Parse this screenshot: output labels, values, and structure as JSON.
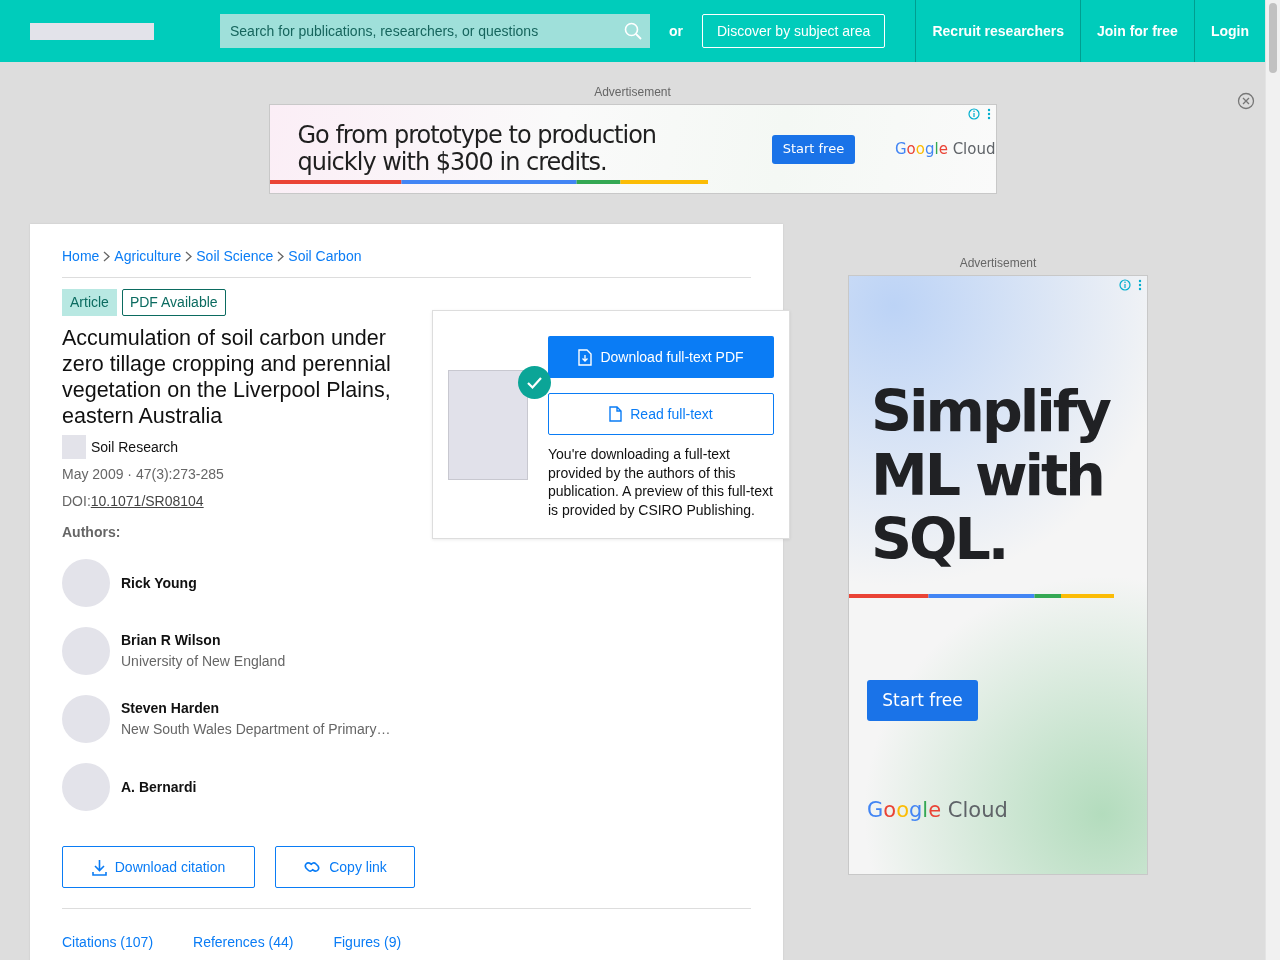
{
  "header": {
    "search": {
      "placeholder": "Search for publications, researchers, or questions"
    },
    "or_text": "or",
    "discover_button": "Discover by subject area",
    "nav_links": [
      "Recruit researchers",
      "Join for free",
      "Login"
    ]
  },
  "top_ad": {
    "label": "Advertisement",
    "headline": "Go from prototype to production quickly with $300 in credits.",
    "button": "Start free",
    "brand": [
      "Google",
      "Cloud"
    ]
  },
  "article": {
    "breadcrumbs": [
      "Home",
      "Agriculture",
      "Soil Science",
      "Soil Carbon"
    ],
    "badges": [
      {
        "label": "Article",
        "kind": "filled"
      },
      {
        "label": "PDF Available",
        "kind": "outline"
      }
    ],
    "title": "Accumulation of soil carbon under zero tillage cropping and perennial vegetation on the Liverpool Plains, eastern Australia",
    "journal": "Soil Research",
    "date": "May 2009 · 47(3):273-285",
    "doi_label": "DOI:",
    "doi": "10.1071/SR08104",
    "authors_label": "Authors:",
    "authors": [
      {
        "name": "Rick Young"
      },
      {
        "name": "Brian R Wilson",
        "affiliation": "University of New England"
      },
      {
        "name": "Steven Harden",
        "affiliation": "New South Wales Department of Primary…"
      },
      {
        "name": "A. Bernardi"
      }
    ],
    "actions": [
      {
        "label": "Download citation",
        "kind": "download"
      },
      {
        "label": "Copy link",
        "kind": "link"
      }
    ],
    "tabs": [
      "Citations (107)",
      "References (44)",
      "Figures (9)"
    ]
  },
  "download_panel": {
    "primary_button": "Download full-text PDF",
    "secondary_button": "Read full-text",
    "note": "You're downloading a full-text provided by the authors of this publication. A preview of this full-text is provided by CSIRO Publishing."
  },
  "side_ad": {
    "label": "Advertisement",
    "headline": "Simplify ML with SQL.",
    "button": "Start free",
    "brand": [
      "Google",
      "Cloud"
    ]
  }
}
